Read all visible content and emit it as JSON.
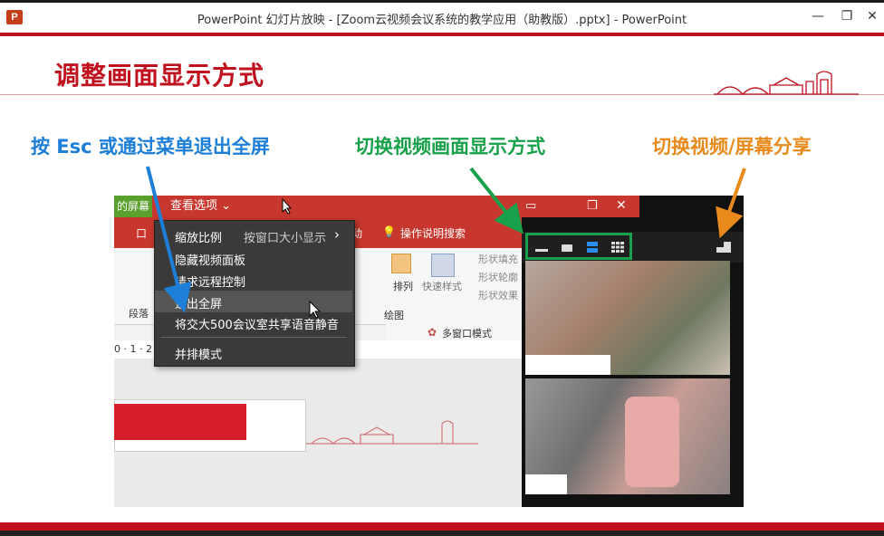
{
  "window": {
    "app_icon": "P",
    "title": "PowerPoint 幻灯片放映 - [Zoom云视频会议系统的教学应用（助教版）.pptx] - PowerPoint",
    "minimize": "—",
    "restore": "❐",
    "close": "✕"
  },
  "slide": {
    "title": "调整画面显示方式"
  },
  "annotations": {
    "esc": "按 Esc 或通过菜单退出全屏",
    "view": "切换视频画面显示方式",
    "share": "切换视频/屏幕分享"
  },
  "screenshot": {
    "left_label": "的屏幕",
    "view_options": "查看选项 ⌄",
    "ribbon_tabs": [
      "口",
      "动",
      "操作说明搜索"
    ],
    "ribbon_items": [
      "段落",
      "排列",
      "快速样式",
      "绘图",
      "形状填充",
      "形状轮廓",
      "形状效果",
      "多窗口模式"
    ],
    "ruler": "0 · 1 · 2          10 · 11 · 12 · 13 · 14 · 15 · 16",
    "menu": {
      "zoom_label": "缩放比例",
      "zoom_value": "按窗口大小显示",
      "zoom_arrow": "›",
      "items": [
        "隐藏视频面板",
        "请求远程控制",
        "退出全屏",
        "将交大500会议室共享语音静音",
        "并排模式"
      ]
    }
  },
  "colors": {
    "brand_red": "#c0111f",
    "esc_blue": "#1e7fd8",
    "view_green": "#18a04a",
    "share_orange": "#e88a1c"
  }
}
